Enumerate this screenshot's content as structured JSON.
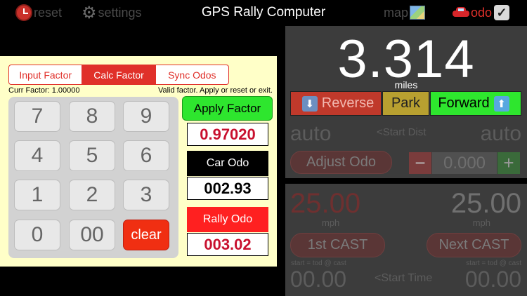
{
  "topbar": {
    "reset_label": "reset",
    "settings_label": "settings",
    "title": "GPS Rally Computer",
    "map_label": "map",
    "odo_label": "odo",
    "icons": {
      "reset": "alarm-clock-icon",
      "settings": "gear-icon",
      "map": "map-icon",
      "odo": "car-icon",
      "check": "checkbox-icon"
    }
  },
  "factor_panel": {
    "tabs": [
      {
        "label": "Input Factor",
        "active": false
      },
      {
        "label": "Calc Factor",
        "active": true
      },
      {
        "label": "Sync Odos",
        "active": false
      }
    ],
    "curr_factor": "Curr Factor: 1.00000",
    "status_message": "Valid factor. Apply or reset or exit.",
    "keypad": [
      "7",
      "8",
      "9",
      "4",
      "5",
      "6",
      "1",
      "2",
      "3",
      "0",
      "00",
      "clear"
    ],
    "apply_label": "Apply Factor",
    "factor_value": "0.97020",
    "car_odo_label": "Car Odo",
    "car_odo_value": "002.93",
    "rally_odo_label": "Rally Odo",
    "rally_odo_value": "003.02"
  },
  "odometer": {
    "distance": "3.314",
    "unit": "miles",
    "reverse_label": "Reverse",
    "park_label": "Park",
    "forward_label": "Forward",
    "auto_left": "auto",
    "start_dist_label": "<Start Dist",
    "auto_right": "auto",
    "adjust_label": "Adjust Odo",
    "minus_label": "−",
    "adjust_value": "0.000",
    "plus_label": "+"
  },
  "cast": {
    "speed_left": "25.00",
    "speed_right": "25.00",
    "unit_left": "mph",
    "unit_right": "mph",
    "first_cast_label": "1st CAST",
    "next_cast_label": "Next CAST",
    "note_left": "start = tod @ cast",
    "note_right": "start = tod @ cast",
    "time_left": "00.00",
    "start_time_label": "<Start Time",
    "time_right": "00.00"
  },
  "colors": {
    "accent_red": "#e0302a",
    "panel_bg": "#3c3c3c",
    "factor_bg": "#ffffc8",
    "green": "#2ee62e"
  }
}
